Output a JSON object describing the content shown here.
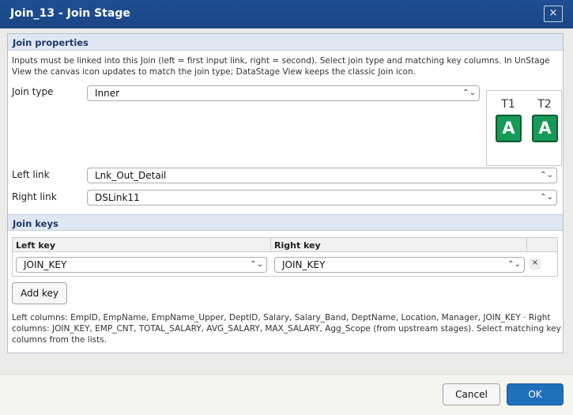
{
  "window": {
    "title": "Join_13 - Join Stage",
    "close_glyph": "×"
  },
  "join_properties": {
    "heading": "Join properties",
    "description": "Inputs must be linked into this Join (left = first input link, right = second). Select join type and matching key columns. In UnStage View the canvas icon updates to match the join type; DataStage View keeps the classic Join icon.",
    "join_type_label": "Join type",
    "join_type_value": "Inner",
    "left_link_label": "Left link",
    "left_link_value": "Lnk_Out_Detail",
    "right_link_label": "Right link",
    "right_link_value": "DSLink11",
    "preview": {
      "t1_label": "T1",
      "t2_label": "T2",
      "t1_letter": "A",
      "t2_letter": "A",
      "tile_color": "#169a57"
    }
  },
  "join_keys": {
    "heading": "Join keys",
    "columns": [
      "Left key",
      "Right key"
    ],
    "rows": [
      {
        "left": "JOIN_KEY",
        "right": "JOIN_KEY",
        "remove_glyph": "×"
      }
    ],
    "add_key_label": "Add key",
    "note": "Left columns: EmpID, EmpName, EmpName_Upper, DeptID, Salary, Salary_Band, DeptName, Location, Manager, JOIN_KEY · Right columns: JOIN_KEY, EMP_CNT, TOTAL_SALARY, AVG_SALARY, MAX_SALARY, Agg_Scope (from upstream stages). Select matching key columns from the lists."
  },
  "footer": {
    "cancel_label": "Cancel",
    "ok_label": "OK"
  },
  "icons": {
    "chevron": "chevron-updown-icon",
    "chevron_glyph": "⌃⌄"
  },
  "colors": {
    "title_bar": "#1f4f93",
    "ok_button": "#1f6fbb"
  }
}
